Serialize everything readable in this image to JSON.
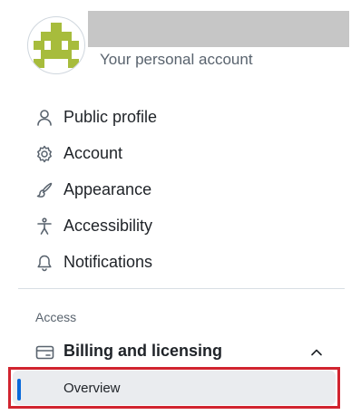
{
  "header": {
    "account_subtitle": "Your personal account",
    "name_redacted": true
  },
  "nav": {
    "items": [
      {
        "label": "Public profile",
        "icon": "person-icon"
      },
      {
        "label": "Account",
        "icon": "gear-icon"
      },
      {
        "label": "Appearance",
        "icon": "paintbrush-icon"
      },
      {
        "label": "Accessibility",
        "icon": "accessibility-icon"
      },
      {
        "label": "Notifications",
        "icon": "bell-icon"
      }
    ]
  },
  "access": {
    "heading": "Access",
    "billing": {
      "label": "Billing and licensing",
      "icon": "credit-card-icon",
      "expanded": true,
      "subitems": [
        {
          "label": "Overview",
          "active": true
        }
      ]
    }
  },
  "colors": {
    "accent": "#0969da",
    "highlight": "#d1242f",
    "avatar": "#a7bc3c"
  }
}
